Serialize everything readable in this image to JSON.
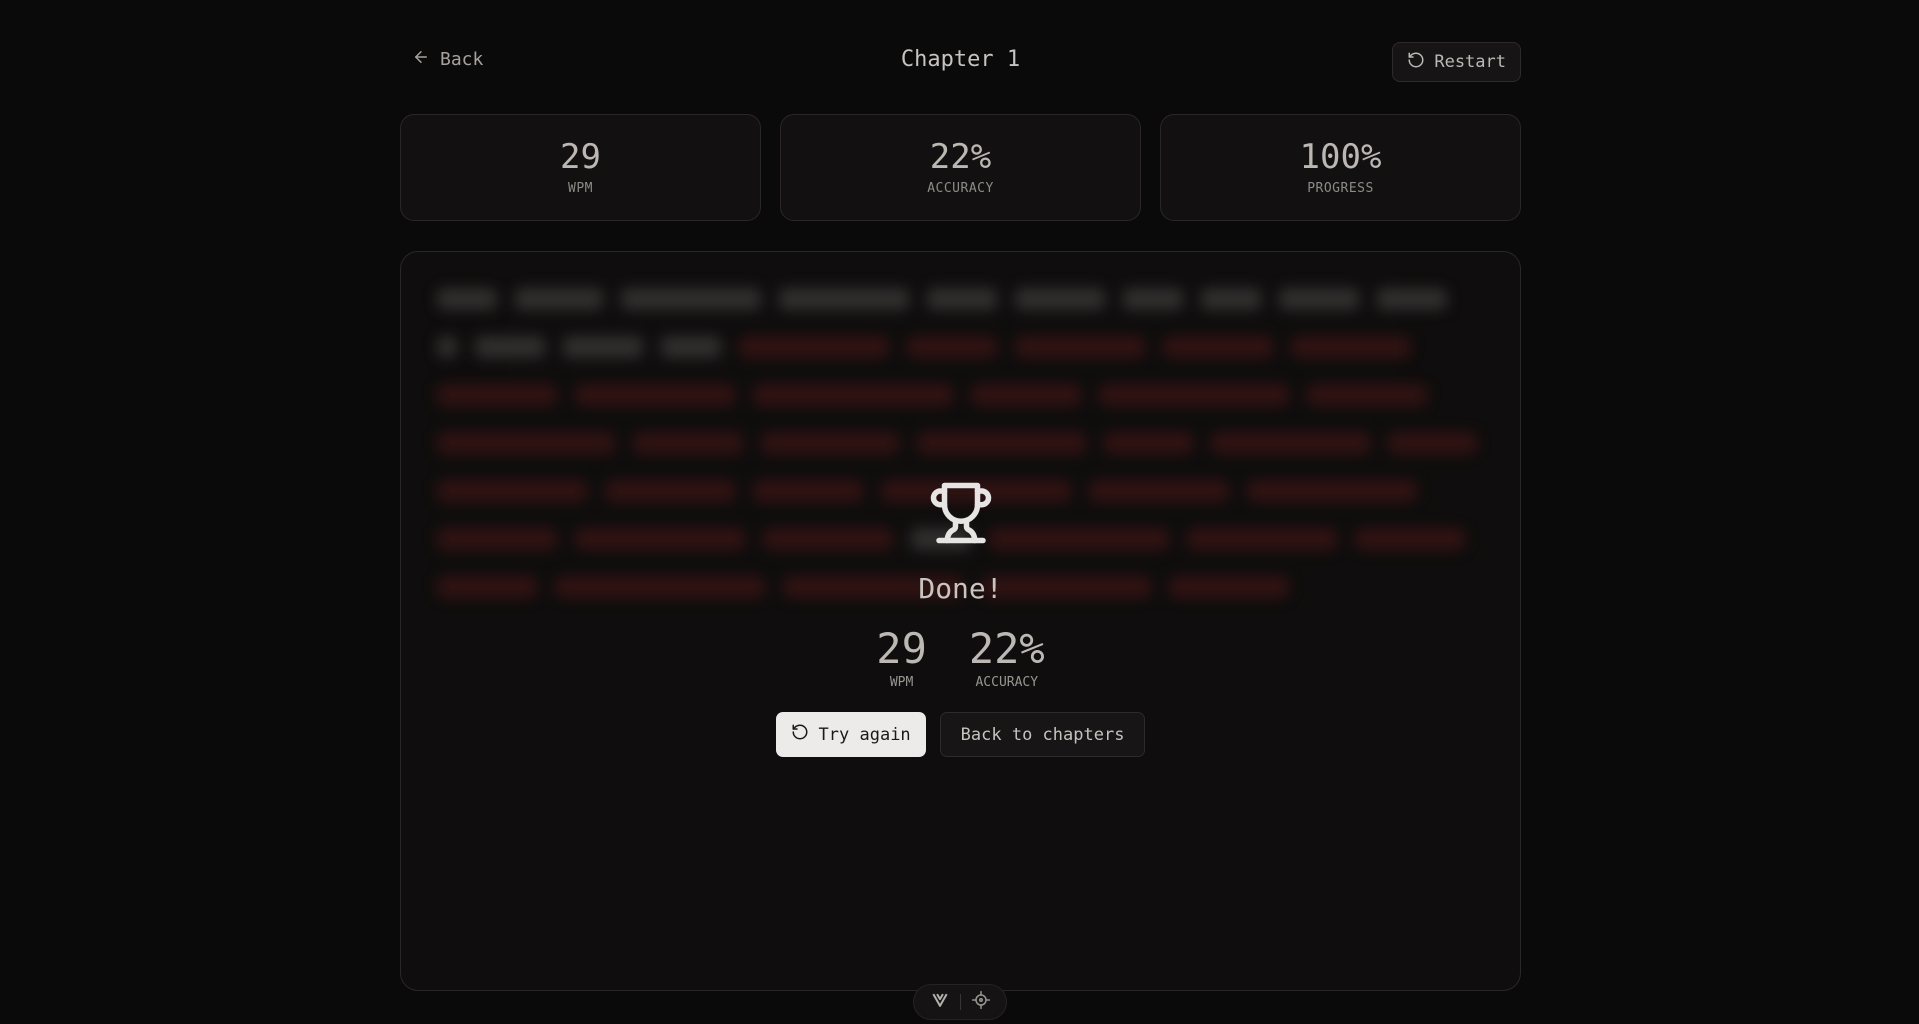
{
  "header": {
    "back_label": "Back",
    "title": "Chapter 1",
    "restart_label": "Restart"
  },
  "stats": [
    {
      "value": "29",
      "label": "WPM"
    },
    {
      "value": "22%",
      "label": "ACCURACY"
    },
    {
      "value": "100%",
      "label": "PROGRESS"
    }
  ],
  "result": {
    "title": "Done!",
    "wpm_value": "29",
    "wpm_label": "WPM",
    "accuracy_value": "22%",
    "accuracy_label": "ACCURACY",
    "try_again_label": "Try again",
    "back_to_chapters_label": "Back to chapters"
  },
  "icons": {
    "back": "arrow-left-icon",
    "restart": "rotate-ccw-icon",
    "trophy": "trophy-icon",
    "toolbar_left": "v-logo-icon",
    "toolbar_right": "crosshair-icon"
  },
  "colors": {
    "background": "#0b0a0a",
    "panel": "#0f0d0d",
    "primary_button": "#ecebea",
    "error_text": "#3a1414"
  }
}
